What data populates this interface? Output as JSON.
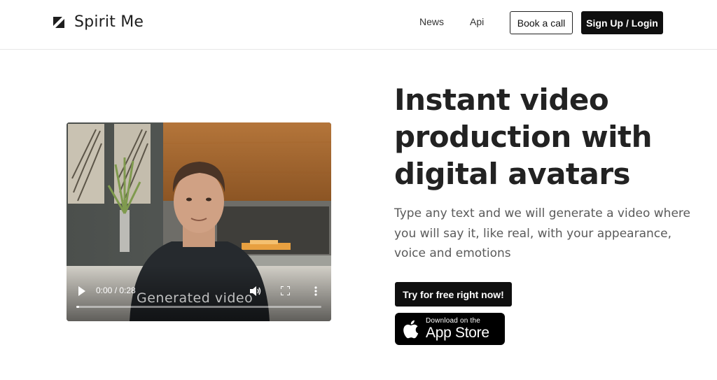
{
  "brand": {
    "name": "Spirit Me"
  },
  "nav": {
    "links": [
      {
        "label": "News"
      },
      {
        "label": "Api"
      }
    ],
    "book_label": "Book a call",
    "signup_label": "Sign Up / Login"
  },
  "video": {
    "time": "0:00 / 0:28",
    "caption": "Generated video",
    "progress": 0.0
  },
  "hero": {
    "title_lines": [
      "Instant video",
      "production with",
      "digital avatars"
    ],
    "subtitle_lines": [
      "Type any text and we will generate a video where",
      "you will say it, like real, with your appearance,",
      "voice and emotions"
    ],
    "cta_label": "Try for free right now!",
    "appstore": {
      "small": "Download on the",
      "big": "App Store"
    }
  },
  "colors": {
    "text": "#222222",
    "button_dark": "#0f0f0f",
    "subtitle": "#5a5a5a"
  },
  "icons": [
    "logo-mark-icon",
    "play-icon",
    "volume-icon",
    "fullscreen-icon",
    "more-options-icon",
    "apple-icon"
  ]
}
